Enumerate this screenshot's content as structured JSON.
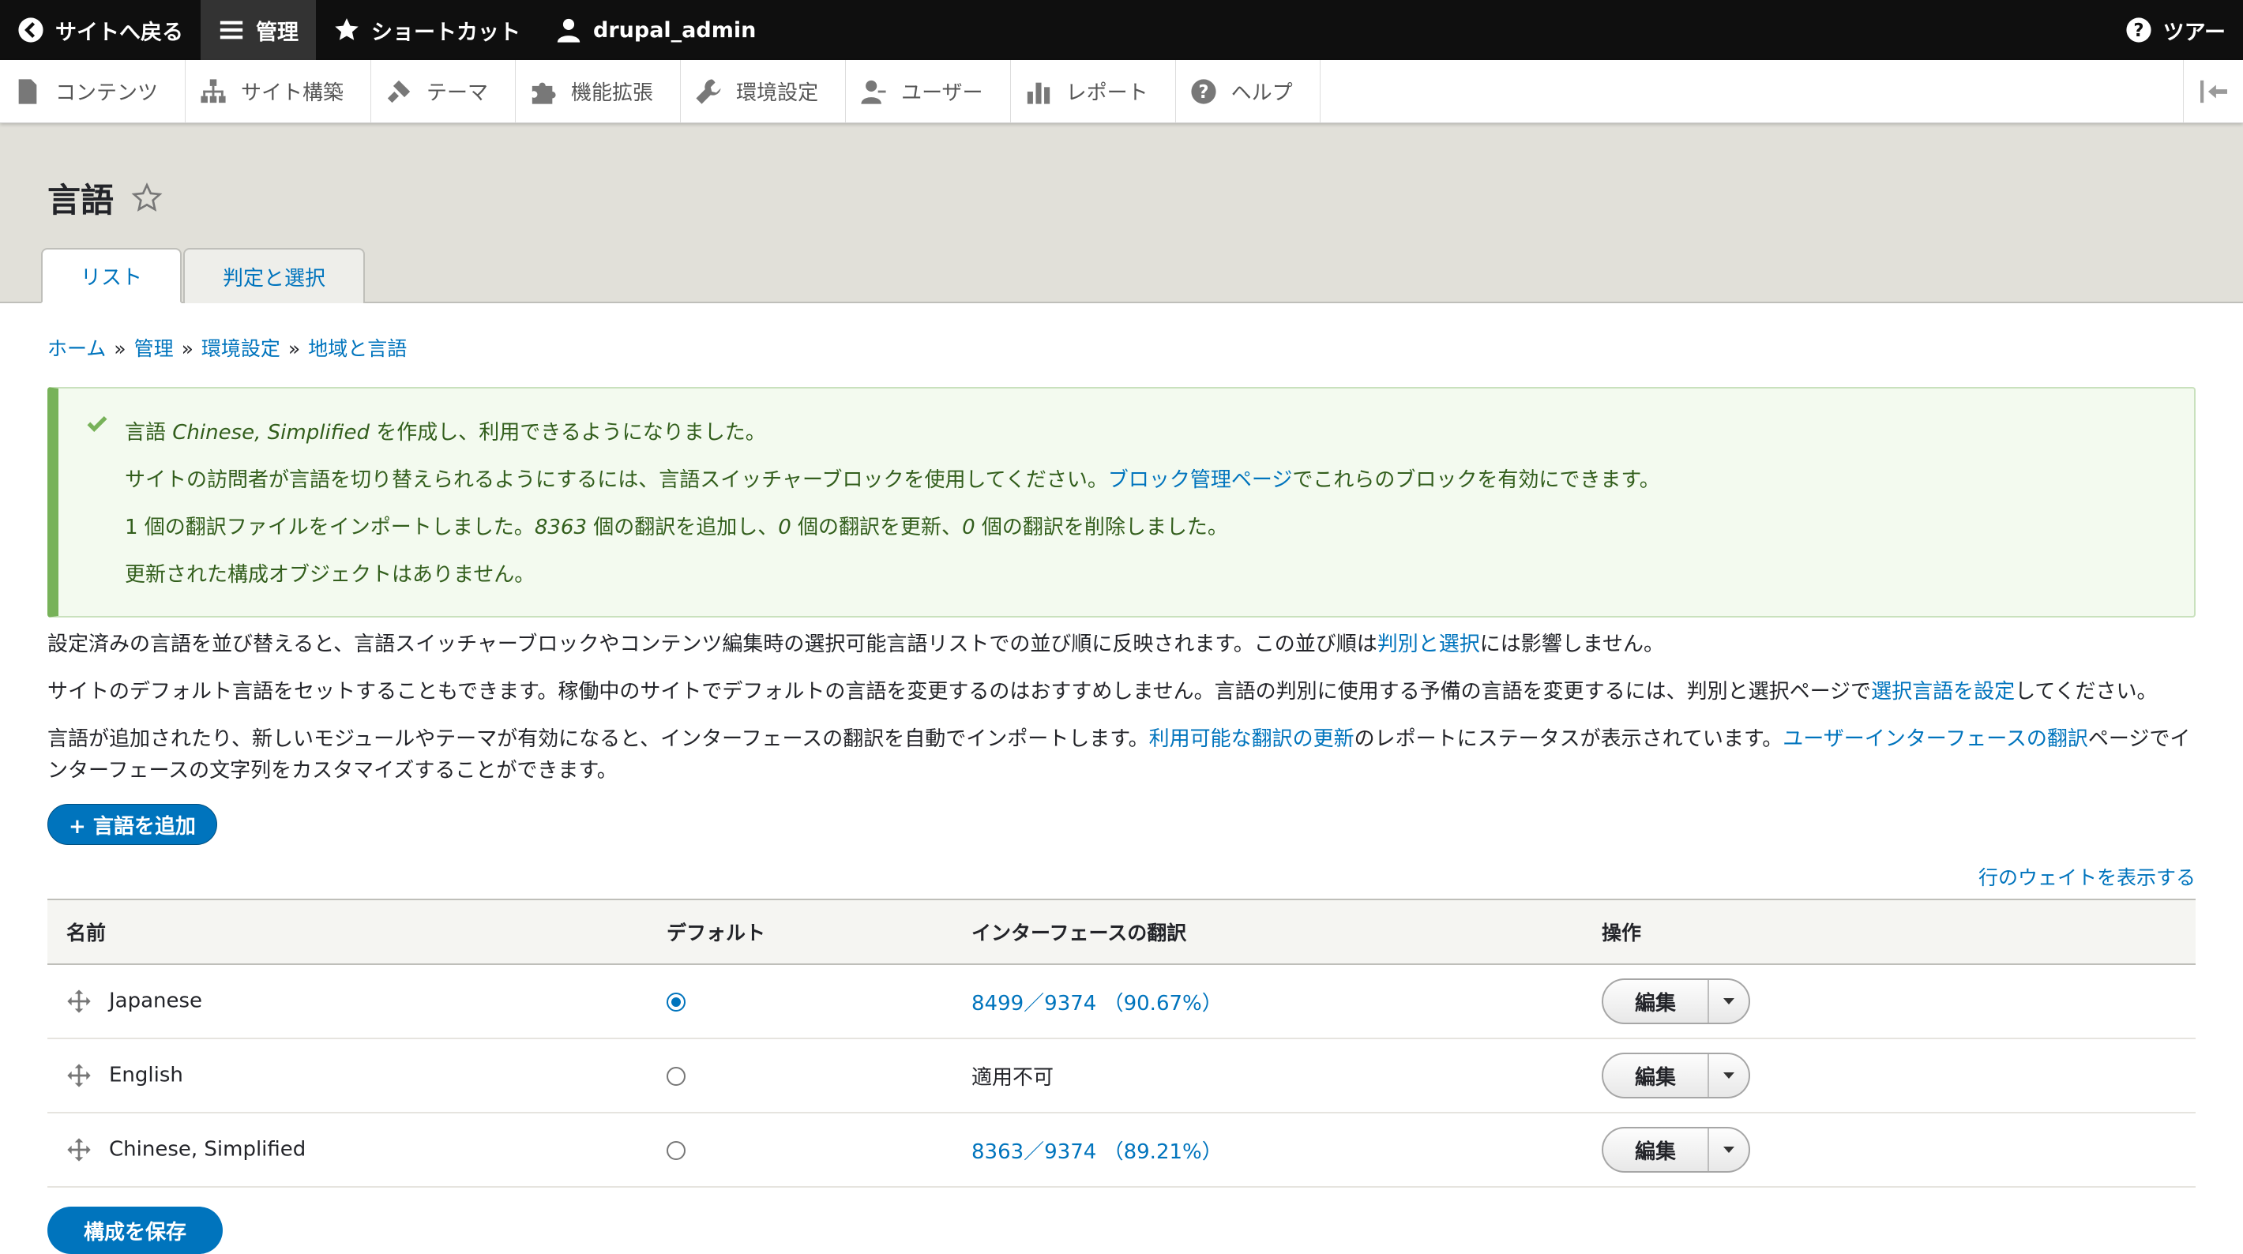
{
  "toolbar": {
    "back": "サイトへ戻る",
    "manage": "管理",
    "shortcuts": "ショートカット",
    "user": "drupal_admin",
    "tour": "ツアー"
  },
  "tray": {
    "items": [
      "コンテンツ",
      "サイト構築",
      "テーマ",
      "機能拡張",
      "環境設定",
      "ユーザー",
      "レポート",
      "ヘルプ"
    ]
  },
  "header": {
    "title": "言語",
    "tabs": [
      "リスト",
      "判定と選択"
    ]
  },
  "breadcrumb": [
    "ホーム",
    "管理",
    "環境設定",
    "地域と言語"
  ],
  "breadcrumb_sep": "»",
  "messages": {
    "m1_pre": "言語 ",
    "m1_lang": "Chinese, Simplified",
    "m1_post": " を作成し、利用できるようになりました。",
    "m2_pre": "サイトの訪問者が言語を切り替えられるようにするには、言語スイッチャーブロックを使用してください。",
    "m2_link": "ブロック管理ページ",
    "m2_post": "でこれらのブロックを有効にできます。",
    "m3_a": "1 個の翻訳ファイルをインポートしました。",
    "m3_added": "8363",
    "m3_b": " 個の翻訳を追加し、",
    "m3_updated": "0",
    "m3_c": " 個の翻訳を更新、",
    "m3_deleted": "0",
    "m3_d": " 個の翻訳を削除しました。",
    "m4": "更新された構成オブジェクトはありません。"
  },
  "description": {
    "p1_pre": "設定済みの言語を並び替えると、言語スイッチャーブロックやコンテンツ編集時の選択可能言語リストでの並び順に反映されます。この並び順は",
    "p1_link": "判別と選択",
    "p1_post": "には影響しません。",
    "p2_pre": "サイトのデフォルト言語をセットすることもできます。稼働中のサイトでデフォルトの言語を変更するのはおすすめしません。言語の判別に使用する予備の言語を変更するには、判別と選択ページで",
    "p2_link": "選択言語を設定",
    "p2_post": "してください。",
    "p3_pre": "言語が追加されたり、新しいモジュールやテーマが有効になると、インターフェースの翻訳を自動でインポートします。",
    "p3_link1": "利用可能な翻訳の更新",
    "p3_mid": "のレポートにステータスが表示されています。",
    "p3_link2": "ユーザーインターフェースの翻訳",
    "p3_post": "ページでインターフェースの文字列をカスタマイズすることができます。"
  },
  "add_button": "+ 言語を追加",
  "weights_link": "行のウェイトを表示する",
  "table": {
    "headers": [
      "名前",
      "デフォルト",
      "インターフェースの翻訳",
      "操作"
    ],
    "rows": [
      {
        "name": "Japanese",
        "default": true,
        "translation": "8499／9374 （90.67%）",
        "is_link": true,
        "op": "編集"
      },
      {
        "name": "English",
        "default": false,
        "translation": "適用不可",
        "is_link": false,
        "op": "編集"
      },
      {
        "name": "Chinese, Simplified",
        "default": false,
        "translation": "8363／9374 （89.21%）",
        "is_link": true,
        "op": "編集"
      }
    ]
  },
  "save_button": "構成を保存",
  "colors": {
    "toolbar_bg": "#0f0f0f",
    "link": "#0074bd",
    "primary_button": "#0074bd",
    "message_bg": "#f3faef",
    "message_border": "#77b259",
    "header_bg": "#e1e0d9"
  }
}
